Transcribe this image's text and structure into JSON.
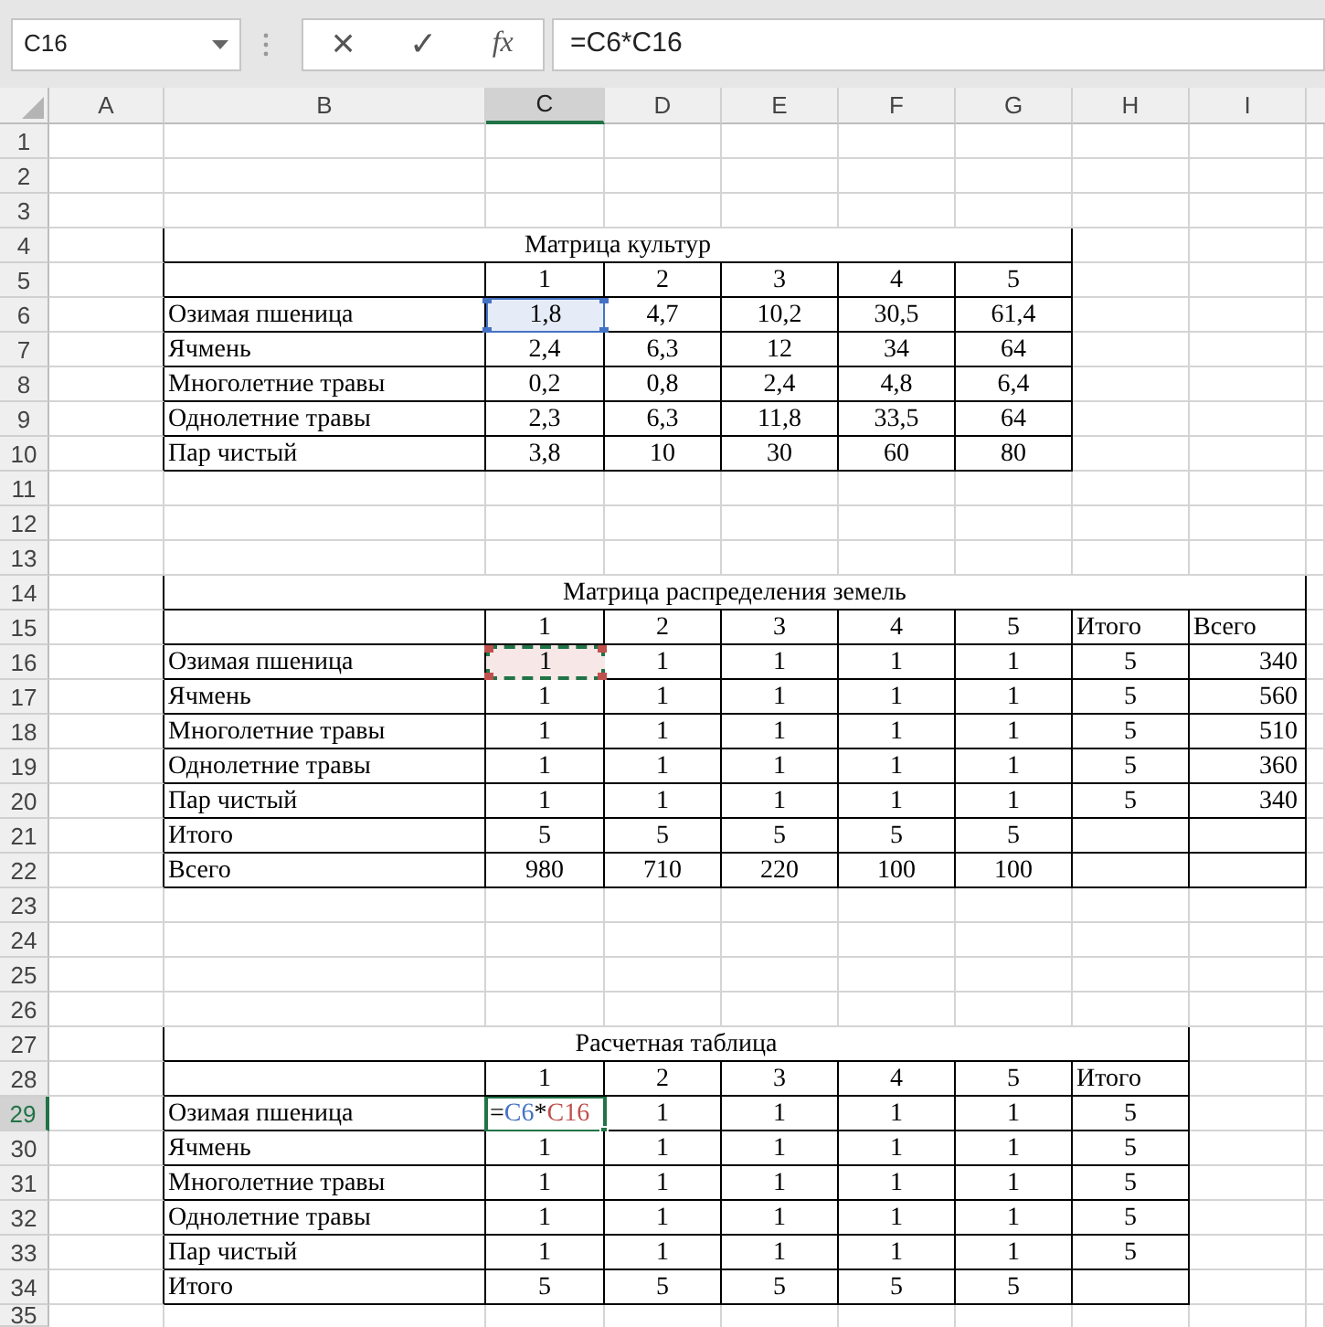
{
  "formula_bar": {
    "name_box": "C16",
    "cancel": "×",
    "enter": "✓",
    "function": "fx",
    "formula": "=C6*C16"
  },
  "sheet": {
    "columns": [
      {
        "label": "A",
        "selected": false
      },
      {
        "label": "B",
        "selected": false
      },
      {
        "label": "C",
        "selected": true
      },
      {
        "label": "D",
        "selected": false
      },
      {
        "label": "E",
        "selected": false
      },
      {
        "label": "F",
        "selected": false
      },
      {
        "label": "G",
        "selected": false
      },
      {
        "label": "H",
        "selected": false
      },
      {
        "label": "I",
        "selected": false
      }
    ],
    "rows": [
      {
        "number": "1",
        "selected": false,
        "kind": "blank"
      },
      {
        "number": "2",
        "selected": false,
        "kind": "blank"
      },
      {
        "number": "3",
        "selected": false,
        "kind": "blank"
      },
      {
        "number": "4",
        "selected": false,
        "kind": "title",
        "title": "Матрица культур"
      },
      {
        "number": "5",
        "selected": false,
        "kind": "header",
        "cells": [
          {
            "text": "1",
            "kind": "index"
          },
          {
            "text": "2",
            "kind": "index"
          },
          {
            "text": "3",
            "kind": "index"
          },
          {
            "text": "4",
            "kind": "index"
          },
          {
            "text": "5",
            "kind": "index"
          }
        ]
      },
      {
        "number": "6",
        "selected": false,
        "kind": "data",
        "label": "Озимая пшеница",
        "cells": [
          {
            "text": "1,8",
            "color": "#4472c4"
          },
          "4,7",
          "10,2",
          "30,5",
          "61,4"
        ]
      },
      {
        "number": "7",
        "selected": false,
        "kind": "data",
        "label": "Ячмень",
        "cells": [
          "2,4",
          "6,3",
          "12",
          "34",
          "64"
        ]
      },
      {
        "number": "8",
        "selected": false,
        "kind": "data",
        "label": "Многолетние травы",
        "cells": [
          "0,2",
          "0,8",
          "2,4",
          "4,8",
          "6,4"
        ]
      },
      {
        "number": "9",
        "selected": false,
        "kind": "data",
        "label": "Однолетние травы",
        "cells": [
          "2,3",
          "6,3",
          "11,8",
          "33,5",
          "64"
        ]
      },
      {
        "number": "10",
        "selected": false,
        "kind": "data",
        "label": "Пар чистый",
        "cells": [
          "3,8",
          "10",
          "30",
          "60",
          "80"
        ]
      },
      {
        "number": "11",
        "selected": false,
        "kind": "blank"
      },
      {
        "number": "12",
        "selected": false,
        "kind": "blank"
      },
      {
        "number": "13",
        "selected": false,
        "kind": "blank"
      },
      {
        "number": "14",
        "selected": false,
        "kind": "title",
        "title": "Матрица распределения земель"
      },
      {
        "number": "15",
        "selected": false,
        "kind": "header",
        "cells": [
          {
            "text": "1",
            "kind": "index"
          },
          {
            "text": "2",
            "kind": "index"
          },
          {
            "text": "3",
            "kind": "index"
          },
          {
            "text": "4",
            "kind": "index"
          },
          {
            "text": "5",
            "kind": "index"
          },
          {
            "text": "Итого",
            "kind": "sum"
          },
          {
            "text": "Всего",
            "kind": "total"
          }
        ]
      },
      {
        "number": "16",
        "selected": false,
        "kind": "data",
        "label": "Озимая пшеница",
        "cells": [
          {
            "text": "1",
            "color": "#c0504d",
            "marquee": true
          },
          "1",
          "1",
          "1",
          "1",
          "5",
          "340"
        ]
      },
      {
        "number": "17",
        "selected": false,
        "kind": "data",
        "label": "Ячмень",
        "cells": [
          "1",
          "1",
          "1",
          "1",
          "1",
          "5",
          "560"
        ]
      },
      {
        "number": "18",
        "selected": false,
        "kind": "data",
        "label": "Многолетние травы",
        "cells": [
          "1",
          "1",
          "1",
          "1",
          "1",
          "5",
          "510"
        ]
      },
      {
        "number": "19",
        "selected": false,
        "kind": "data",
        "label": "Однолетние травы",
        "cells": [
          "1",
          "1",
          "1",
          "1",
          "1",
          "5",
          "360"
        ]
      },
      {
        "number": "20",
        "selected": false,
        "kind": "data",
        "label": "Пар чистый",
        "cells": [
          "1",
          "1",
          "1",
          "1",
          "1",
          "5",
          "340"
        ]
      },
      {
        "number": "21",
        "selected": false,
        "kind": "data",
        "label": "Итого",
        "cells": [
          "5",
          "5",
          "5",
          "5",
          "5"
        ]
      },
      {
        "number": "22",
        "selected": false,
        "kind": "data",
        "label": "Всего",
        "cells": [
          "980",
          "710",
          "220",
          "100",
          "100"
        ]
      },
      {
        "number": "23",
        "selected": false,
        "kind": "blank"
      },
      {
        "number": "24",
        "selected": false,
        "kind": "blank"
      },
      {
        "number": "25",
        "selected": false,
        "kind": "blank"
      },
      {
        "number": "26",
        "selected": false,
        "kind": "blank"
      },
      {
        "number": "27",
        "selected": false,
        "kind": "title",
        "title": "Расчетная таблица"
      },
      {
        "number": "28",
        "selected": false,
        "kind": "header",
        "cells": [
          {
            "text": "1",
            "kind": "index"
          },
          {
            "text": "2",
            "kind": "index"
          },
          {
            "text": "3",
            "kind": "index"
          },
          {
            "text": "4",
            "kind": "index"
          },
          {
            "text": "5",
            "kind": "index"
          },
          {
            "text": "Итого",
            "kind": "sum"
          }
        ]
      },
      {
        "number": "29",
        "selected": true,
        "kind": "data",
        "label": "Озимая пшеница",
        "cells": [
          {
            "active": true,
            "parts": [
              {
                "text": "=",
                "color": "#000000"
              },
              {
                "text": "C6",
                "color": "#4472c4"
              },
              {
                "text": "*",
                "color": "#000000"
              },
              {
                "text": "C16",
                "color": "#c0504d"
              }
            ]
          },
          "1",
          "1",
          "1",
          "1",
          "5"
        ]
      },
      {
        "number": "30",
        "selected": false,
        "kind": "data",
        "label": "Ячмень",
        "cells": [
          "1",
          "1",
          "1",
          "1",
          "1",
          "5"
        ]
      },
      {
        "number": "31",
        "selected": false,
        "kind": "data",
        "label": "Многолетние травы",
        "cells": [
          "1",
          "1",
          "1",
          "1",
          "1",
          "5"
        ]
      },
      {
        "number": "32",
        "selected": false,
        "kind": "data",
        "label": "Однолетние травы",
        "cells": [
          "1",
          "1",
          "1",
          "1",
          "1",
          "5"
        ]
      },
      {
        "number": "33",
        "selected": false,
        "kind": "data",
        "label": "Пар чистый",
        "cells": [
          "1",
          "1",
          "1",
          "1",
          "1",
          "5"
        ]
      },
      {
        "number": "34",
        "selected": false,
        "kind": "data",
        "label": "Итого",
        "cells": [
          "5",
          "5",
          "5",
          "5",
          "5"
        ]
      },
      {
        "number": "35",
        "selected": false,
        "kind": "blank"
      }
    ]
  }
}
